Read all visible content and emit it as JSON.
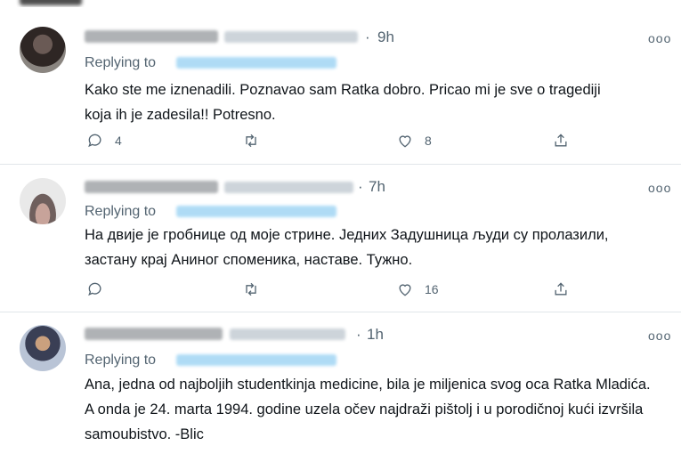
{
  "tweets": [
    {
      "dot": "·",
      "time": "9h",
      "replying_label": "Replying to",
      "text": "Kako ste me iznenadili. Poznavao sam Ratka dobro. Pricao mi je sve o tragediji koja ih je zadesila!! Potresno.",
      "reply_count": "4",
      "retweet_count": "",
      "like_count": "8"
    },
    {
      "dot": "·",
      "time": "7h",
      "replying_label": "Replying to",
      "text": "На двије је гробнице од моје стрине. Једних Задушница људи су пролазили, застану крај Аниног споменика, наставе. Тужно.",
      "reply_count": "",
      "retweet_count": "",
      "like_count": "16"
    },
    {
      "dot": "·",
      "time": "1h",
      "replying_label": "Replying to",
      "text": "Ana, jedna od najboljih studentkinja medicine, bila je miljenica svog oca Ratka Mladića. A onda je 24. marta 1994. godine uzela očev najdraži pištolj i u porodičnoj kući izvršila samoubistvo. -Blic",
      "reply_count": "",
      "retweet_count": "",
      "like_count": ""
    }
  ],
  "icons": {
    "more": "more-horizontal-icon",
    "reply": "reply-bubble-icon",
    "retweet": "retweet-icon",
    "like": "heart-icon",
    "share": "share-icon"
  },
  "more_glyph": "ooo",
  "colors": {
    "text": "#0f1419",
    "muted": "#536471",
    "link": "#1d9bf0",
    "divider": "#e1e6ea"
  }
}
